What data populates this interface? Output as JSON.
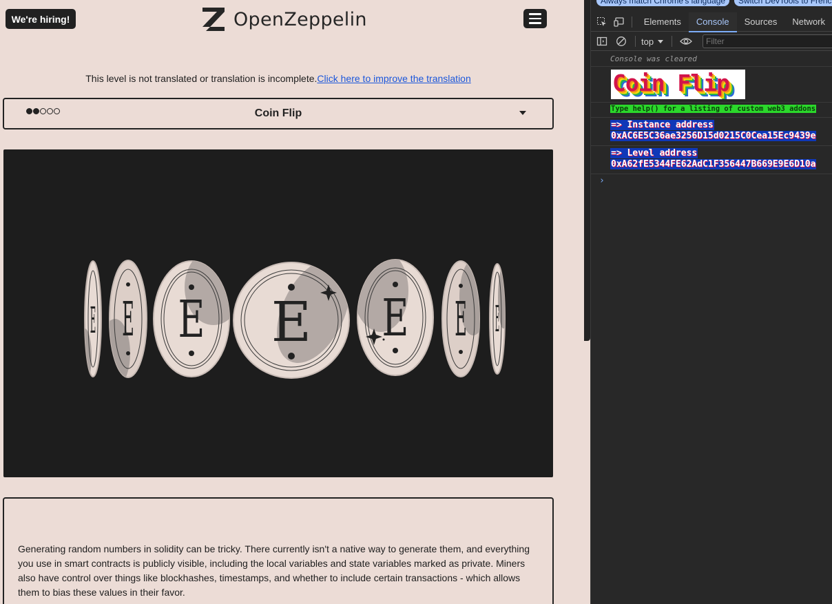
{
  "header": {
    "hiring_label": "We're hiring!",
    "logo_text": "OpenZeppelin",
    "logo_letter": "Z"
  },
  "notice": {
    "text": "This level is not translated or translation is incomplete.",
    "link_text": "Click here to improve the translation"
  },
  "level": {
    "title": "Coin Flip",
    "difficulty_filled": 2,
    "difficulty_total": 5
  },
  "hero": {
    "coin_letter": "E"
  },
  "description": {
    "text": "Generating random numbers in solidity can be tricky. There currently isn't a native way to generate them, and everything you use in smart contracts is publicly visible, including the local variables and state variables marked as private. Miners also have control over things like blockhashes, timestamps, and whether to include certain transactions - which allows them to bias these values in their favor."
  },
  "devtools": {
    "lang_chip_1": "Always match Chrome's language",
    "lang_chip_2": "Switch DevTools to French",
    "tabs": [
      "Elements",
      "Console",
      "Sources",
      "Network"
    ],
    "active_tab": "Console",
    "context": "top",
    "filter_placeholder": "Filter",
    "console": {
      "cleared": "Console was cleared",
      "banner": "Coin Flip",
      "help": "Type help() for a listing of custom web3 addons",
      "instance_label": "=> Instance address",
      "instance_value": "0xAC6E5C36ae3256D15d0215C0Cea15Ec9439e",
      "level_label": "=> Level address",
      "level_value": "0xA62fE5344FE62AdC1F356447B669E9E6D10a"
    }
  },
  "colors": {
    "page_bg": "#ecdcd6",
    "dark": "#212121",
    "link": "#1a56db",
    "devtools_bg": "#282828",
    "devtools_accent": "#a8c7fa",
    "help_green": "#2bd82b",
    "address_blue": "#1038b8"
  }
}
